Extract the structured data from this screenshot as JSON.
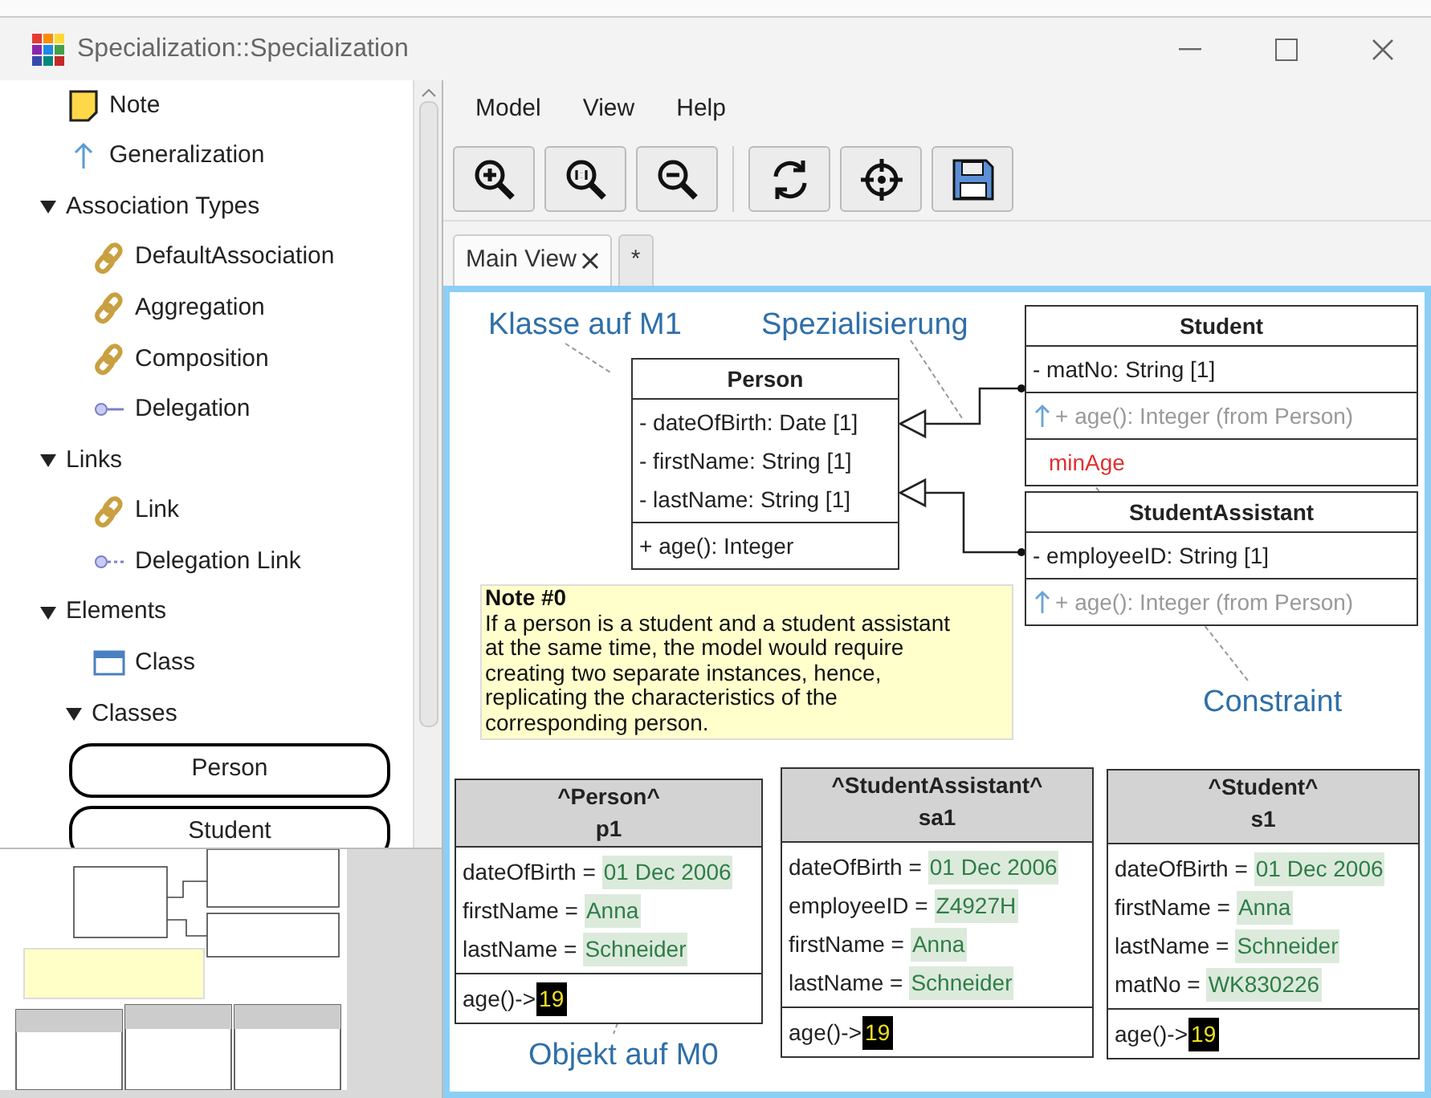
{
  "window": {
    "title": "Specialization::Specialization"
  },
  "tree": [
    {
      "kind": "note",
      "label": "Note"
    },
    {
      "kind": "generalization",
      "label": "Generalization"
    },
    {
      "kind": "group",
      "label": "Association Types",
      "expanded": true,
      "children": [
        {
          "kind": "association",
          "label": "DefaultAssociation"
        },
        {
          "kind": "association",
          "label": "Aggregation"
        },
        {
          "kind": "association",
          "label": "Composition"
        },
        {
          "kind": "delegation",
          "label": "Delegation"
        }
      ]
    },
    {
      "kind": "group",
      "label": "Links",
      "expanded": true,
      "children": [
        {
          "kind": "association",
          "label": "Link"
        },
        {
          "kind": "delegation-link",
          "label": "Delegation Link"
        }
      ]
    },
    {
      "kind": "group",
      "label": "Elements",
      "expanded": true,
      "children": [
        {
          "kind": "class",
          "label": "Class"
        },
        {
          "kind": "group",
          "label": "Classes",
          "expanded": true,
          "children": [
            {
              "kind": "class-button",
              "label": "Person"
            },
            {
              "kind": "class-button",
              "label": "Student"
            }
          ]
        }
      ]
    }
  ],
  "menu": [
    "Model",
    "View",
    "Help"
  ],
  "toolbar": [
    [
      {
        "kind": "zoom-in"
      },
      {
        "kind": "zoom-reset"
      },
      {
        "kind": "zoom-out"
      }
    ],
    [
      {
        "kind": "refresh"
      },
      {
        "kind": "center"
      },
      {
        "kind": "save"
      }
    ]
  ],
  "tabs": [
    {
      "label": "Main View",
      "closable": true,
      "selected": true
    },
    {
      "label": "*",
      "closable": false,
      "selected": false
    }
  ],
  "labels": [
    {
      "text": "Klasse auf M1",
      "kind": "klasse"
    },
    {
      "text": "Spezialisierung",
      "kind": "spez"
    },
    {
      "text": "Constraint",
      "kind": "constraint"
    },
    {
      "text": "Objekt auf M0",
      "kind": "objekt"
    }
  ],
  "classes": [
    {
      "name": "Person",
      "kind": "person",
      "compartments": [
        [
          {
            "kind": "attribute",
            "text": "- dateOfBirth: Date [1]"
          },
          {
            "kind": "attribute",
            "text": "- firstName: String [1]"
          },
          {
            "kind": "attribute",
            "text": "- lastName: String [1]"
          }
        ],
        [
          {
            "kind": "attribute",
            "text": "+ age(): Integer"
          }
        ]
      ]
    },
    {
      "name": "Student",
      "kind": "student",
      "compartments": [
        [
          {
            "kind": "attribute",
            "text": "- matNo: String [1]"
          }
        ],
        [
          {
            "kind": "inherited",
            "text": "+ age(): Integer (from Person)"
          }
        ],
        [
          {
            "kind": "constraint",
            "text": "minAge"
          }
        ]
      ]
    },
    {
      "name": "StudentAssistant",
      "kind": "assistant",
      "compartments": [
        [
          {
            "kind": "attribute",
            "text": "- employeeID: String [1]"
          }
        ],
        [
          {
            "kind": "inherited",
            "text": "+ age(): Integer (from Person)"
          }
        ]
      ]
    }
  ],
  "note": {
    "title": "Note #0",
    "text": "If a person is a student and a student assistant at the same time, the model would require creating two separate instances, hence, replicating the characteristics of the corresponding person."
  },
  "objects": [
    {
      "type": "^Person^",
      "name": "p1",
      "slots": [
        {
          "name": "dateOfBirth =",
          "value": "01 Dec 2006"
        },
        {
          "name": "firstName =",
          "value": "Anna"
        },
        {
          "name": "lastName =",
          "value": "Schneider"
        }
      ],
      "operation": "age()->",
      "result": "19"
    },
    {
      "type": "^StudentAssistant^",
      "name": "sa1",
      "slots": [
        {
          "name": "dateOfBirth =",
          "value": "01 Dec 2006"
        },
        {
          "name": "employeeID =",
          "value": "Z4927H"
        },
        {
          "name": "firstName =",
          "value": "Anna"
        },
        {
          "name": "lastName =",
          "value": "Schneider"
        }
      ],
      "operation": "age()->",
      "result": "19"
    },
    {
      "type": "^Student^",
      "name": "s1",
      "slots": [
        {
          "name": "dateOfBirth =",
          "value": "01 Dec 2006"
        },
        {
          "name": "firstName =",
          "value": "Anna"
        },
        {
          "name": "lastName =",
          "value": "Schneider"
        },
        {
          "name": "matNo =",
          "value": "WK830226"
        }
      ],
      "operation": "age()->",
      "result": "19"
    }
  ]
}
